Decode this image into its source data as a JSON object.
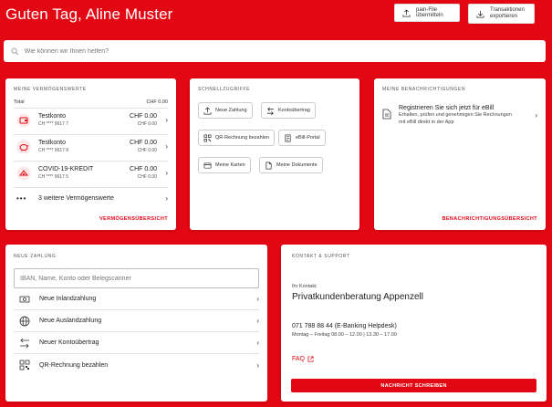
{
  "header": {
    "greeting": "Guten Tag, Aline Muster",
    "pain_button_label": "pain-File übermitteln",
    "export_button_line1": "Transaktionen",
    "export_button_line2": "exportieren"
  },
  "search": {
    "placeholder": "Wie können wir Ihnen helfen?"
  },
  "assets": {
    "title": "MEINE VERMÖGENSWERTE",
    "total_label": "Total",
    "total_value": "CHF 0.00",
    "accounts": [
      {
        "name": "Testkonto",
        "number": "CH **** 9617 7",
        "amount": "CHF 0.00",
        "amount_sub": "CHF 0.00",
        "icon": "wallet-icon"
      },
      {
        "name": "Testkonto",
        "number": "CH **** 9617 8",
        "amount": "CHF 0.00",
        "amount_sub": "CHF 0.00",
        "icon": "piggy-bank-icon"
      },
      {
        "name": "COVID-19-KREDIT",
        "number": "CH **** 9617 5",
        "amount": "CHF 0.00",
        "amount_sub": "CHF 0.00",
        "icon": "credit-icon"
      }
    ],
    "more_label": "3 weitere Vermögenswerte",
    "overview_link": "VERMÖGENSÜBERSICHT"
  },
  "quick": {
    "title": "SCHNELLZUGRIFFE",
    "buttons": [
      {
        "label": "Neue Zahlung",
        "icon": "upload-icon"
      },
      {
        "label": "Kontoübertrag",
        "icon": "transfer-icon"
      },
      {
        "label": "QR-Rechnung bezahlen",
        "icon": "qr-code-icon"
      },
      {
        "label": "eBill-Portal",
        "icon": "ebill-icon"
      },
      {
        "label": "Meine Karten",
        "icon": "card-icon"
      },
      {
        "label": "Meine Dokumente",
        "icon": "document-icon"
      }
    ]
  },
  "notifications": {
    "title": "MEINE BENACHRICHTIGUNGEN",
    "item_title": "Registrieren Sie sich jetzt für eBill",
    "item_text": "Erhalten, prüfen und genehmigen Sie Rechnungen mit eBill direkt in der App",
    "overview_link": "BENACHRICHTIGUNGSÜBERSICHT"
  },
  "payment": {
    "title": "NEUE ZAHLUNG",
    "iban_placeholder": "IBAN, Name, Konto oder Belegscanner",
    "items": [
      {
        "label": "Neue Inlandzahlung",
        "icon": "banknote-icon"
      },
      {
        "label": "Neue Auslandzahlung",
        "icon": "globe-icon"
      },
      {
        "label": "Neuer Kontoübertrag",
        "icon": "transfer-icon"
      },
      {
        "label": "QR-Rechnung bezahlen",
        "icon": "qr-code-icon"
      }
    ]
  },
  "contact": {
    "title": "KONTAKT & SUPPORT",
    "sub": "Ihr Kontakt",
    "name": "Privatkundenberatung Appenzell",
    "phone": "071 788 88 44 (E-Banking Helpdesk)",
    "hours": "Montag – Freitag    08.00 – 12.00 | 13.30 – 17.00",
    "faq": "FAQ",
    "button": "NACHRICHT SCHREIBEN"
  },
  "colors": {
    "brand": "#e30613",
    "card": "#ffffff"
  }
}
